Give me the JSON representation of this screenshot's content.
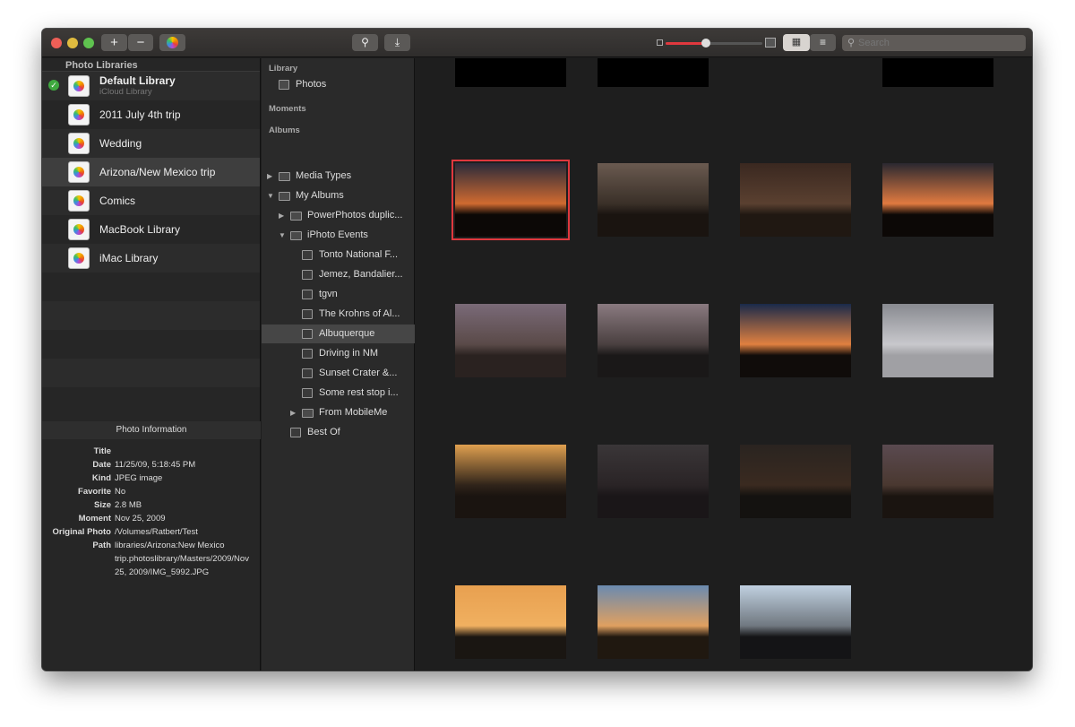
{
  "toolbar": {
    "add": "+",
    "remove": "−",
    "search_placeholder": "Search",
    "slider_value": 0.42,
    "view_mode": "grid"
  },
  "colors": {
    "accent": "#e0383e",
    "close": "#ed5f57",
    "min": "#e0bb3f",
    "max": "#5fc24f",
    "check": "#3fa93f"
  },
  "sidebar": {
    "header": "Photo Libraries",
    "libraries": [
      {
        "name": "Default Library",
        "sub": "iCloud Library",
        "active": true
      },
      {
        "name": "2011 July 4th trip"
      },
      {
        "name": "Wedding"
      },
      {
        "name": "Arizona/New Mexico trip",
        "selected": true
      },
      {
        "name": "Comics"
      },
      {
        "name": "MacBook Library"
      },
      {
        "name": "iMac Library"
      }
    ]
  },
  "info": {
    "header": "Photo Information",
    "rows": [
      {
        "k": "Title",
        "v": ""
      },
      {
        "k": "Date",
        "v": "11/25/09, 5:18:45 PM"
      },
      {
        "k": "Kind",
        "v": "JPEG image"
      },
      {
        "k": "Favorite",
        "v": "No"
      },
      {
        "k": "Size",
        "v": "2.8 MB"
      },
      {
        "k": "Moment",
        "v": "Nov 25, 2009"
      },
      {
        "k": "Original Photo Path",
        "v": "/Volumes/Ratbert/Test libraries/Arizona:New Mexico trip.photoslibrary/Masters/2009/Nov 25, 2009/IMG_5992.JPG"
      }
    ]
  },
  "tree": {
    "library": "Library",
    "photos": "Photos",
    "moments": "Moments",
    "albums": "Albums",
    "items": [
      {
        "label": "Media Types",
        "level": 0,
        "arrow": "▶",
        "folder": true
      },
      {
        "label": "My Albums",
        "level": 0,
        "arrow": "▼",
        "folder": true
      },
      {
        "label": "PowerPhotos duplic...",
        "level": 1,
        "arrow": "▶",
        "folder": true
      },
      {
        "label": "iPhoto Events",
        "level": 1,
        "arrow": "▼",
        "folder": true
      },
      {
        "label": "Tonto National F...",
        "level": 2
      },
      {
        "label": "Jemez, Bandalier...",
        "level": 2
      },
      {
        "label": "tgvn",
        "level": 2
      },
      {
        "label": "The Krohns of Al...",
        "level": 2
      },
      {
        "label": "Albuquerque",
        "level": 2,
        "selected": true
      },
      {
        "label": "Driving in NM",
        "level": 2
      },
      {
        "label": "Sunset Crater &...",
        "level": 2
      },
      {
        "label": "Some rest stop i...",
        "level": 2
      },
      {
        "label": "From MobileMe",
        "level": 2,
        "arrow": "▶",
        "folder": true
      },
      {
        "label": "Best Of",
        "level": 1
      }
    ]
  },
  "photos": [
    [
      "#000",
      "#000"
    ],
    [
      "#000",
      "#000"
    ],
    null,
    [
      "#000",
      "#000"
    ],
    [
      "#2a2a3a",
      "#d06a30",
      "#0c0806",
      true
    ],
    [
      "#6a5a50",
      "#3a3028",
      "#1a1410"
    ],
    [
      "#3a2820",
      "#5a4030",
      "#201812"
    ],
    [
      "#2a2830",
      "#e07a40",
      "#0c0806"
    ],
    [
      "#7a6a78",
      "#5a4a48",
      "#2a2220"
    ],
    [
      "#8a7a80",
      "#4a4040",
      "#1a1818"
    ],
    [
      "#1a2a4a",
      "#e08040",
      "#100c0a"
    ],
    [
      "#888a90",
      "#c8c8cc",
      "#a0a0a4"
    ],
    [
      "#e0a050",
      "#30241a",
      "#1a1410"
    ],
    [
      "#3a3638",
      "#2a2426",
      "#1a1618"
    ],
    [
      "#2a2420",
      "#3a2a20",
      "#141210"
    ],
    [
      "#5a4a50",
      "#4a3830",
      "#1a1410"
    ],
    [
      "#e8a050",
      "#f0b060",
      "#1a1612"
    ],
    [
      "#6a8ab0",
      "#e0a060",
      "#201810"
    ],
    [
      "#c0d0e0",
      "#707880",
      "#141416"
    ]
  ]
}
